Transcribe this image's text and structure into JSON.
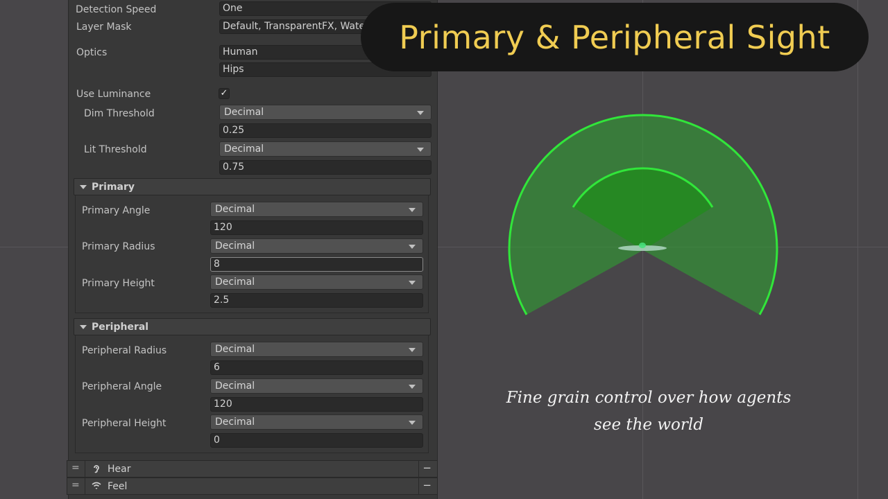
{
  "inspector": {
    "detection_speed": {
      "label": "Detection Speed",
      "value": "One"
    },
    "layer_mask": {
      "label": "Layer Mask",
      "value": "Default, TransparentFX, Water"
    },
    "optics": {
      "label": "Optics",
      "value": "Human",
      "value2": "Hips"
    },
    "use_luminance": {
      "label": "Use Luminance",
      "checked": true,
      "check_glyph": "✓"
    },
    "dim_threshold": {
      "label": "Dim Threshold",
      "mode": "Decimal",
      "value": "0.25"
    },
    "lit_threshold": {
      "label": "Lit Threshold",
      "mode": "Decimal",
      "value": "0.75"
    },
    "primary": {
      "title": "Primary",
      "angle": {
        "label": "Primary Angle",
        "mode": "Decimal",
        "value": "120"
      },
      "radius": {
        "label": "Primary Radius",
        "mode": "Decimal",
        "value": "8"
      },
      "height": {
        "label": "Primary Height",
        "mode": "Decimal",
        "value": "2.5"
      }
    },
    "peripheral": {
      "title": "Peripheral",
      "radius": {
        "label": "Peripheral Radius",
        "mode": "Decimal",
        "value": "6"
      },
      "angle": {
        "label": "Peripheral Angle",
        "mode": "Decimal",
        "value": "120"
      },
      "height": {
        "label": "Peripheral Height",
        "mode": "Decimal",
        "value": "0"
      }
    },
    "components": [
      {
        "name": "Hear",
        "icon": "ear-icon",
        "handle": "=",
        "remove": "−"
      },
      {
        "name": "Feel",
        "icon": "wifi-feel-icon",
        "handle": "=",
        "remove": "−"
      }
    ]
  },
  "banner": {
    "title": "Primary & Peripheral Sight"
  },
  "caption": {
    "line1": "Fine grain control over how agents",
    "line2": "see the world"
  },
  "colors": {
    "accent_yellow": "#f0cc52",
    "cone_green": "#31e63a",
    "cone_fill": "#2ea82f"
  }
}
